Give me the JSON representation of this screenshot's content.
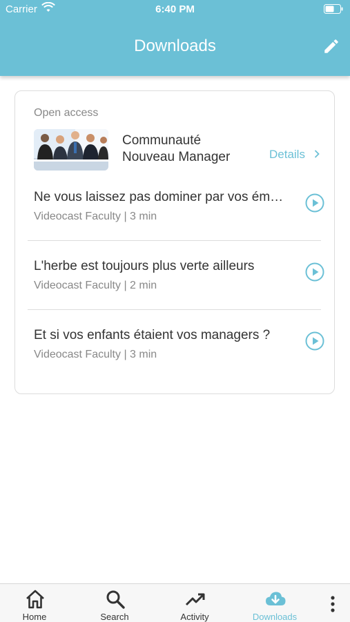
{
  "status_bar": {
    "carrier": "Carrier",
    "time": "6:40 PM"
  },
  "header": {
    "title": "Downloads"
  },
  "card": {
    "section_label": "Open access",
    "course": {
      "title_line1": "Communauté",
      "title_line2": "Nouveau Manager",
      "details_label": "Details"
    },
    "items": [
      {
        "title": "Ne vous laissez pas dominer par vos émotions",
        "meta": "Videocast Faculty | 3 min"
      },
      {
        "title": "L'herbe est toujours plus verte ailleurs",
        "meta": "Videocast Faculty | 2 min"
      },
      {
        "title": "Et si vos enfants étaient vos managers ?",
        "meta": "Videocast Faculty | 3 min"
      }
    ]
  },
  "tabbar": {
    "tabs": [
      {
        "label": "Home",
        "icon": "home-icon"
      },
      {
        "label": "Search",
        "icon": "search-icon"
      },
      {
        "label": "Activity",
        "icon": "trending-up-icon"
      },
      {
        "label": "Downloads",
        "icon": "cloud-download-icon",
        "active": true
      }
    ]
  },
  "colors": {
    "accent": "#6bc0d6",
    "text": "#333333",
    "muted": "#888888"
  }
}
